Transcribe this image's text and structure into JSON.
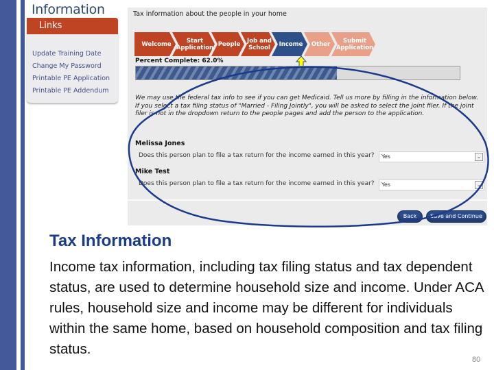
{
  "sidebar": {
    "title": "Information",
    "links_header": "Links",
    "links": [
      {
        "label": "Update Training Date"
      },
      {
        "label": "Change My Password"
      },
      {
        "label": "Printable PE Application"
      },
      {
        "label": "Printable PE Addendum"
      }
    ]
  },
  "panel": {
    "title": "Tax information about the people in your home",
    "steps": [
      {
        "label": "Welcome",
        "state": "done",
        "color": "#bf4424"
      },
      {
        "label": "Start Application",
        "state": "done",
        "color": "#bf4424"
      },
      {
        "label": "People",
        "state": "done",
        "color": "#bf4424"
      },
      {
        "label": "Job and School",
        "state": "done",
        "color": "#bf4424"
      },
      {
        "label": "Income",
        "state": "current",
        "color": "#2c5087"
      },
      {
        "label": "Other",
        "state": "upcoming",
        "color": "#e8a088"
      },
      {
        "label": "Submit Application",
        "state": "upcoming",
        "color": "#e8a088"
      }
    ],
    "percent_label": "Percent Complete: 62.0%",
    "percent_complete": 62.0,
    "intro_line1": "We may use the federal tax info to see if you can get Medicaid. Tell us more by filling in the information below.",
    "intro_line2": "If you select a tax filing status of \"Married - Filing Jointly\", you will be asked to select the joint filer. If the joint filer is not in the dropdown return to the people pages and add the person to the application.",
    "people": [
      {
        "name": "Melissa Jones",
        "question": "Does this person plan to file a tax return for the income earned in this year?",
        "answer": "Yes"
      },
      {
        "name": "Mike Test",
        "question": "Does this person plan to file a tax return for the income earned in this year?",
        "answer": "Yes"
      }
    ],
    "back_label": "Back",
    "save_label": "Save and Continue"
  },
  "colors": {
    "accent_blue": "#44599a",
    "link_header": "#bf4424",
    "highlight_circle": "#1c3a8c",
    "pointer_arrow": "#ffff00"
  },
  "slide": {
    "heading": "Tax Information",
    "body": "Income tax information, including tax filing status and tax dependent status, are used to determine household size and income.  Under ACA rules, household size and income may be different for individuals within the same home, based on household composition and tax filing status.",
    "page_number": "80"
  }
}
